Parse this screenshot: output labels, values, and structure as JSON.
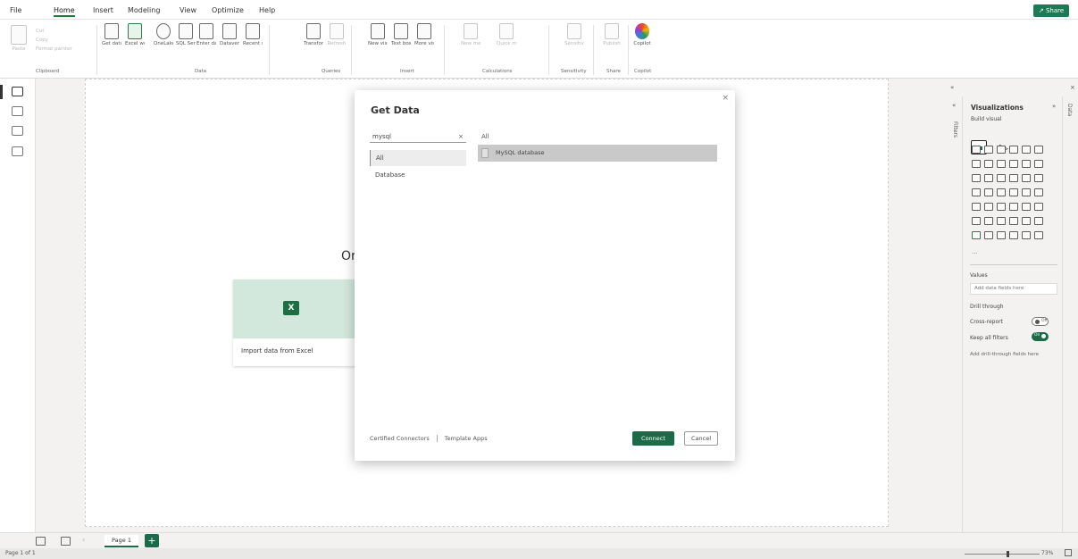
{
  "menu": {
    "items": [
      "File",
      "Home",
      "Insert",
      "Modeling",
      "View",
      "Optimize",
      "Help"
    ],
    "active": "Home",
    "share_label": "Share"
  },
  "ribbon": {
    "clipboard": {
      "paste": "Paste",
      "cut": "Cut",
      "copy": "Copy",
      "format_painter": "Format painter",
      "group": "Clipboard"
    },
    "data": {
      "items": [
        "Get data",
        "Excel workbook",
        "OneLake catalog",
        "SQL Server",
        "Enter data",
        "Dataverse",
        "Recent sources"
      ],
      "group": "Data"
    },
    "queries": {
      "items": [
        "Transform data",
        "Refresh"
      ],
      "group": "Queries"
    },
    "insert": {
      "items": [
        "New visual",
        "Text box",
        "More visuals"
      ],
      "group": "Insert"
    },
    "calculations": {
      "items": [
        "New measure",
        "Quick measure"
      ],
      "group": "Calculations"
    },
    "sensitivity": {
      "items": [
        "Sensitivity"
      ],
      "group": "Sensitivity"
    },
    "share": {
      "items": [
        "Publish"
      ],
      "group": "Share"
    },
    "copilot": {
      "items": [
        "Copilot"
      ],
      "group": "Copilot"
    }
  },
  "canvas": {
    "heading": "Or",
    "excel_card_label": "Import data from Excel"
  },
  "dialog": {
    "title": "Get Data",
    "close": "×",
    "select_value": "mysql",
    "search_value": "All",
    "categories": [
      "All",
      "Database"
    ],
    "result": "MySQL database",
    "links": [
      "Certified Connectors",
      "Template Apps"
    ],
    "connect": "Connect",
    "cancel": "Cancel"
  },
  "viz_pane": {
    "title": "Visualizations",
    "subtitle": "Build visual",
    "collapse": "«",
    "expand": "»",
    "close": "×",
    "values_label": "Values",
    "values_placeholder": "Add data fields here",
    "drill_through": "Drill through",
    "cross_report": "Cross-report",
    "cross_report_state": "Off",
    "keep_filters": "Keep all filters",
    "keep_filters_state": "On",
    "drill_placeholder": "Add drill-through fields here"
  },
  "filters_pane": {
    "label": "Filters",
    "collapse": "«"
  },
  "data_pane": {
    "label": "Data"
  },
  "pages": {
    "tab": "Page 1",
    "add": "+"
  },
  "status": {
    "left": "Page 1 of 1",
    "zoom": "73%"
  }
}
